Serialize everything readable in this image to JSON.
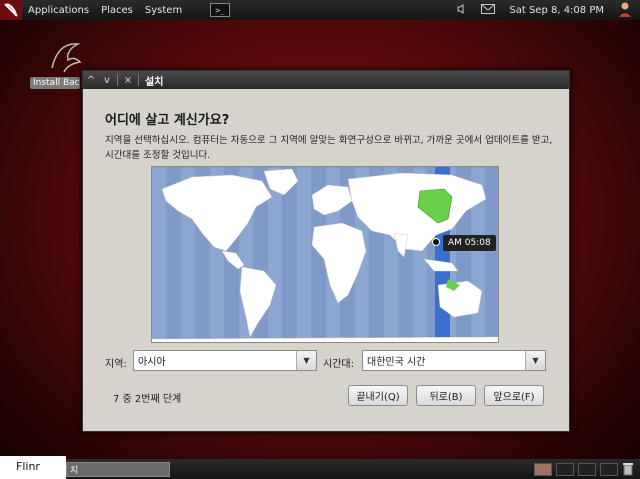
{
  "top_panel": {
    "menus": [
      "Applications",
      "Places",
      "System"
    ],
    "terminal_glyph": ">_",
    "clock": "Sat Sep  8,  4:08 PM"
  },
  "desktop": {
    "icon_label": "Install Bac"
  },
  "dialog": {
    "title": "설치",
    "titlebar_buttons": [
      "^",
      "v",
      "×"
    ],
    "heading": "어디에 살고 계신가요?",
    "description": "지역을 선택하십시오. 컴퓨터는 자동으로 그 지역에 알맞는 화면구성으로 바뀌고, 가까운 곳에서 업데이트를 받고, 시간대를 조정할 것입니다.",
    "map_tooltip": "AM 05:08",
    "region_label": "지역:",
    "region_value": "아시아",
    "timezone_label": "시간대:",
    "timezone_value": "대한민국 시간",
    "step_text": "7 중 2번째 단계",
    "buttons": {
      "quit": "끝내기(Q)",
      "back": "뒤로(B)",
      "forward": "앞으로(F)"
    }
  },
  "bottom_panel": {
    "left_label": "Flinr",
    "task_label": "치"
  },
  "colors": {
    "map_ocean": "#7f99c8",
    "land": "#ffffff",
    "selected_zone": "#6ad04a",
    "timezone_band": "#3a6fcf"
  }
}
